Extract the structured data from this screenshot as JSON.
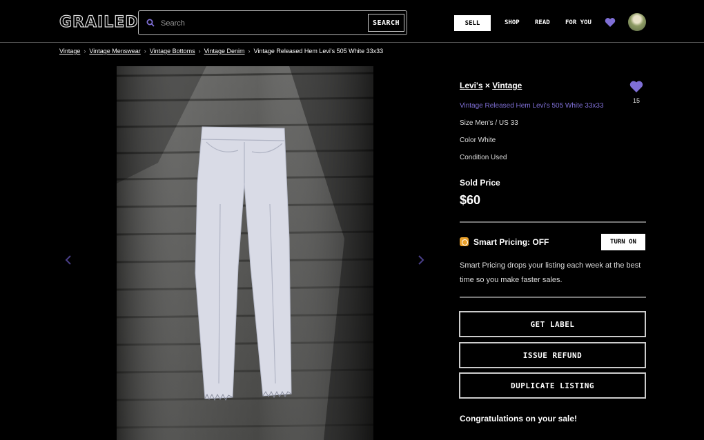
{
  "header": {
    "logo": "GRAILED",
    "search": {
      "placeholder": "Search",
      "button_label": "SEARCH"
    },
    "sell_label": "SELL",
    "nav": [
      "SHOP",
      "READ",
      "FOR YOU"
    ]
  },
  "breadcrumb": [
    "Vintage",
    "Vintage Menswear",
    "Vintage Bottoms",
    "Vintage Denim",
    "Vintage Released Hem Levi's 505 White 33x33"
  ],
  "listing": {
    "brand": "Levi's",
    "brand_sep": " × ",
    "brand2": "Vintage",
    "likes": "15",
    "title": "Vintage Released Hem Levi's 505 White 33x33",
    "size": "Size Men's / US 33",
    "color": "Color White",
    "condition": "Condition Used",
    "sold_label": "Sold Price",
    "sold_price": "$60"
  },
  "smart_pricing": {
    "label": "Smart Pricing: OFF",
    "button": "TURN ON",
    "description": "Smart Pricing drops your listing each week at the best time so you make faster sales."
  },
  "actions": [
    "GET LABEL",
    "ISSUE REFUND",
    "DUPLICATE LISTING"
  ],
  "congrats": "Congratulations on your sale!",
  "colors": {
    "accent": "#7f6fd6",
    "background": "#000000",
    "smart_pricing_icon": "#e8a02c"
  },
  "icons": [
    "search-icon",
    "heart-icon",
    "avatar",
    "chevron-left-icon",
    "chevron-right-icon",
    "smart-pricing-icon"
  ]
}
